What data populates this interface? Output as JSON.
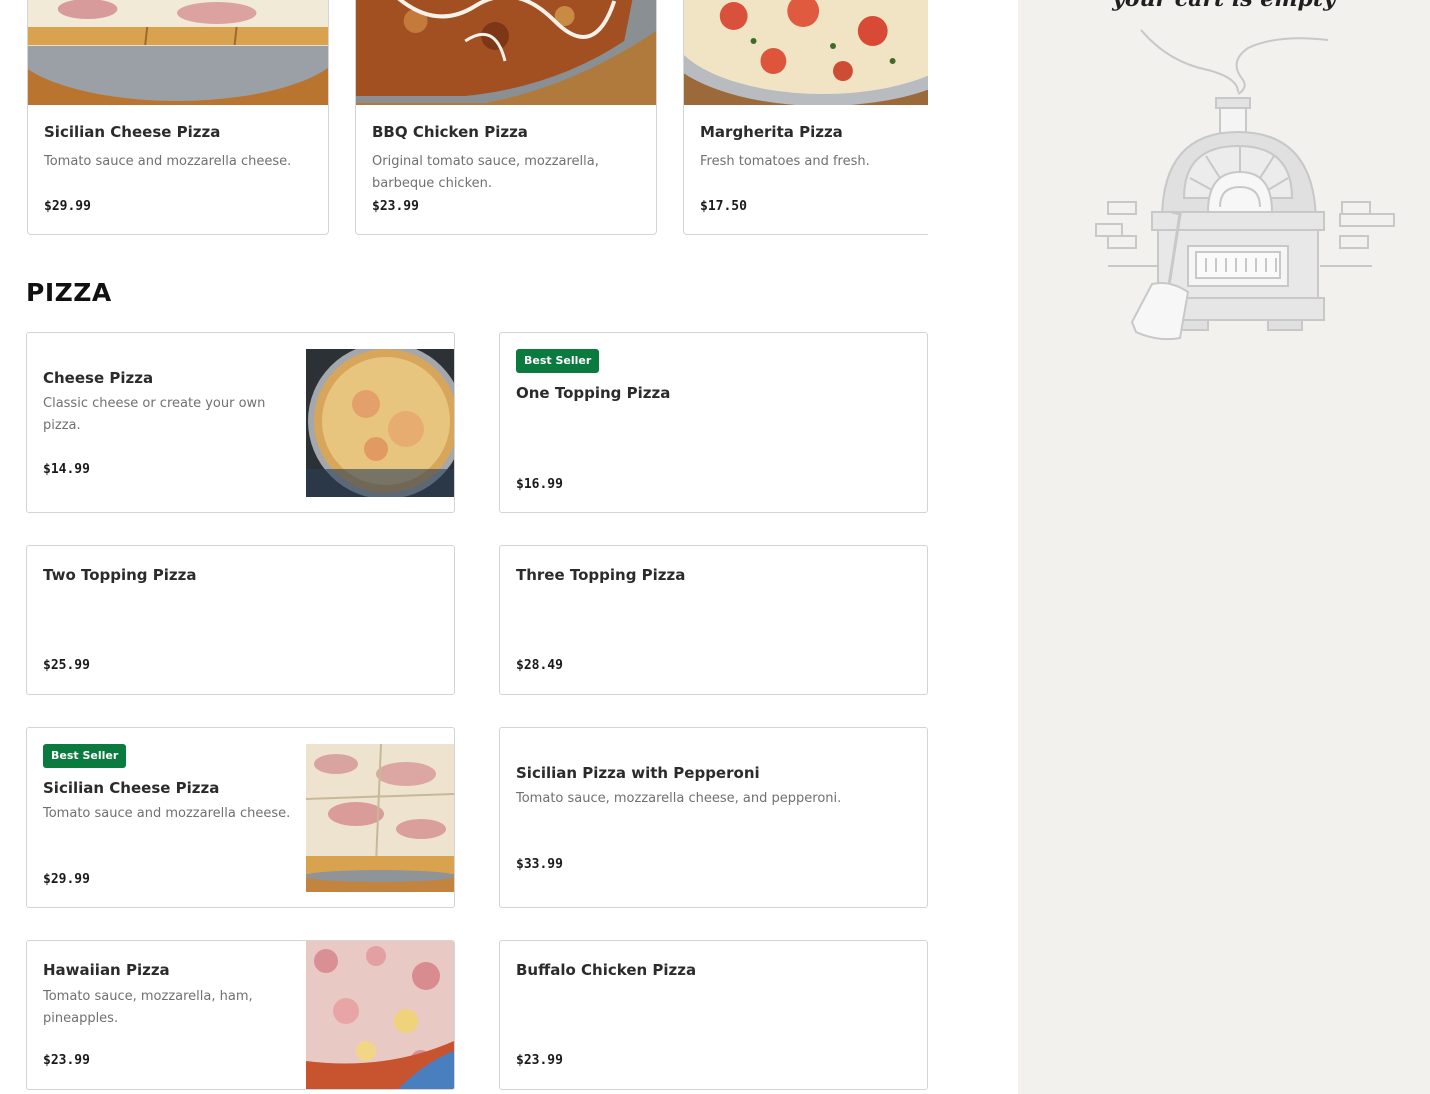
{
  "featured": [
    {
      "name": "Sicilian Cheese Pizza",
      "desc": "Tomato sauce and mozzarella cheese.",
      "price": "$29.99",
      "image": "sicilian-pizza-photo"
    },
    {
      "name": "BBQ Chicken Pizza",
      "desc": "Original tomato sauce, mozzarella, barbeque chicken.",
      "price": "$23.99",
      "image": "bbq-chicken-pizza-photo"
    },
    {
      "name": "Margherita Pizza",
      "desc": "Fresh tomatoes and fresh.",
      "price": "$17.50",
      "image": "margherita-pizza-photo"
    }
  ],
  "section": {
    "title": "PIZZA"
  },
  "items": [
    {
      "name": "Cheese Pizza",
      "desc": "Classic cheese or create your own pizza.",
      "price": "$14.99",
      "badge": "",
      "image": "cheese-pizza-photo"
    },
    {
      "name": "One Topping Pizza",
      "desc": "",
      "price": "$16.99",
      "badge": "Best Seller",
      "image": ""
    },
    {
      "name": "Two Topping Pizza",
      "desc": "",
      "price": "$25.99",
      "badge": "",
      "image": ""
    },
    {
      "name": "Three Topping Pizza",
      "desc": "",
      "price": "$28.49",
      "badge": "",
      "image": ""
    },
    {
      "name": "Sicilian Cheese Pizza",
      "desc": "Tomato sauce and mozzarella cheese.",
      "price": "$29.99",
      "badge": "Best Seller",
      "image": "sicilian-pizza-photo"
    },
    {
      "name": "Sicilian Pizza with Pepperoni",
      "desc": "Tomato sauce, mozzarella cheese, and pepperoni.",
      "price": "$33.99",
      "badge": "",
      "image": ""
    },
    {
      "name": "Hawaiian Pizza",
      "desc": "Tomato sauce, mozzarella, ham, pineapples.",
      "price": "$23.99",
      "badge": "",
      "image": "hawaiian-pizza-photo"
    },
    {
      "name": "Buffalo Chicken Pizza",
      "desc": "",
      "price": "$23.99",
      "badge": "",
      "image": ""
    }
  ],
  "cart": {
    "empty_text": "your cart is empty",
    "illustration": "pizza-oven-icon"
  },
  "colors": {
    "badge": "#0a7a3e",
    "cart_bg": "#f2f1ee",
    "border": "#d4d4d4"
  }
}
